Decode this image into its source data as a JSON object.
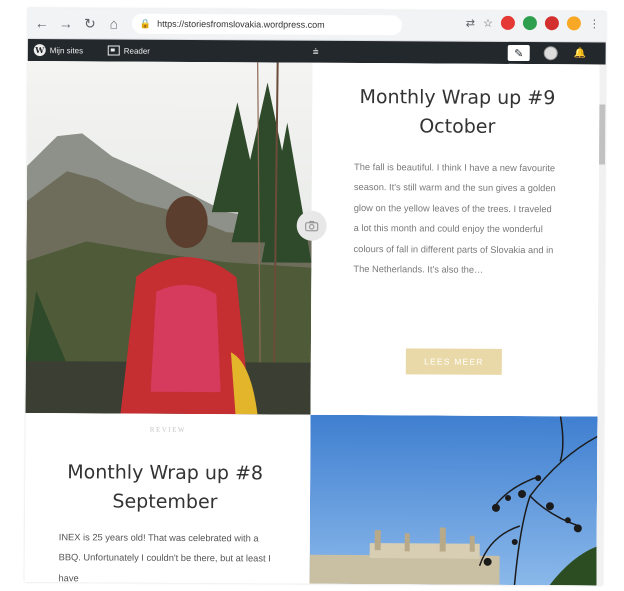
{
  "browser": {
    "url": "https://storiesfromslovakia.wordpress.com"
  },
  "wpbar": {
    "my_sites_label": "Mijn sites",
    "reader_label": "Reader"
  },
  "posts": [
    {
      "title": "Monthly Wrap up #9 October",
      "excerpt": "The fall is beautiful. I think I have a new favourite season. It's still warm and the sun gives a golden glow on the yellow leaves of the trees. I traveled a lot this month and could enjoy the wonderful colours of fall in different parts of Slovakia and in The Netherlands. It's also the…",
      "button_label": "LEES MEER"
    },
    {
      "category": "REVIEW",
      "title": "Monthly Wrap up #8 September",
      "excerpt": "INEX is 25 years old! That was celebrated with a BBQ. Unfortunately I couldn't be there, but at least I have"
    }
  ],
  "colors": {
    "admin_bar": "#23282d",
    "button_bg": "#ead9a8",
    "title_text": "#333333"
  }
}
